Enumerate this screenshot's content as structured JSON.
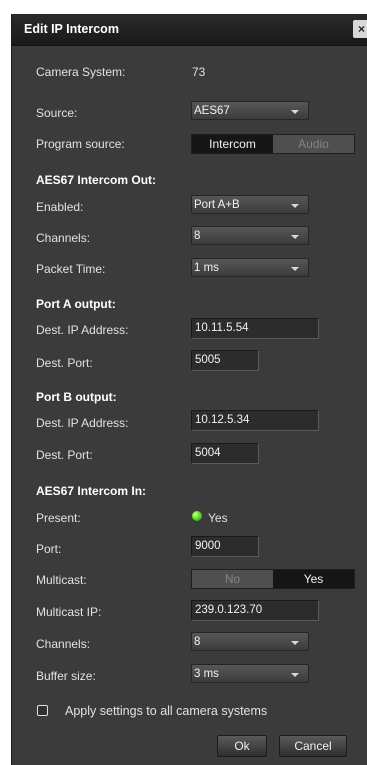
{
  "dialog": {
    "title": "Edit IP Intercom",
    "close_label": "×"
  },
  "camera_system": {
    "label": "Camera System:",
    "value": "73"
  },
  "source": {
    "label": "Source:",
    "value": "AES67"
  },
  "program_source": {
    "label": "Program source:",
    "options": [
      "Intercom",
      "Audio"
    ],
    "selected": "Intercom"
  },
  "aes67_out": {
    "heading": "AES67 Intercom Out:",
    "enabled": {
      "label": "Enabled:",
      "value": "Port A+B"
    },
    "channels": {
      "label": "Channels:",
      "value": "8"
    },
    "packet_time": {
      "label": "Packet Time:",
      "value": "1 ms"
    }
  },
  "port_a": {
    "heading": "Port A output:",
    "dest_ip": {
      "label": "Dest. IP Address:",
      "value": "10.11.5.54"
    },
    "dest_port": {
      "label": "Dest. Port:",
      "value": "5005"
    }
  },
  "port_b": {
    "heading": "Port B output:",
    "dest_ip": {
      "label": "Dest. IP Address:",
      "value": "10.12.5.34"
    },
    "dest_port": {
      "label": "Dest. Port:",
      "value": "5004"
    }
  },
  "aes67_in": {
    "heading": "AES67 Intercom In:",
    "present": {
      "label": "Present:",
      "value": "Yes",
      "indicator_color": "#4fd21a"
    },
    "port": {
      "label": "Port:",
      "value": "9000"
    },
    "multicast": {
      "label": "Multicast:",
      "options": [
        "No",
        "Yes"
      ],
      "selected": "Yes"
    },
    "multicast_ip": {
      "label": "Multicast IP:",
      "value": "239.0.123.70"
    },
    "channels": {
      "label": "Channels:",
      "value": "8"
    },
    "buffer_size": {
      "label": "Buffer size:",
      "value": "3 ms"
    }
  },
  "apply_all": {
    "label": "Apply settings to all camera systems",
    "checked": false
  },
  "buttons": {
    "ok": "Ok",
    "cancel": "Cancel"
  },
  "colors": {
    "background": "#3b3b3b",
    "titlebar": "#1f1f1f",
    "selected_segment": "#161616"
  }
}
